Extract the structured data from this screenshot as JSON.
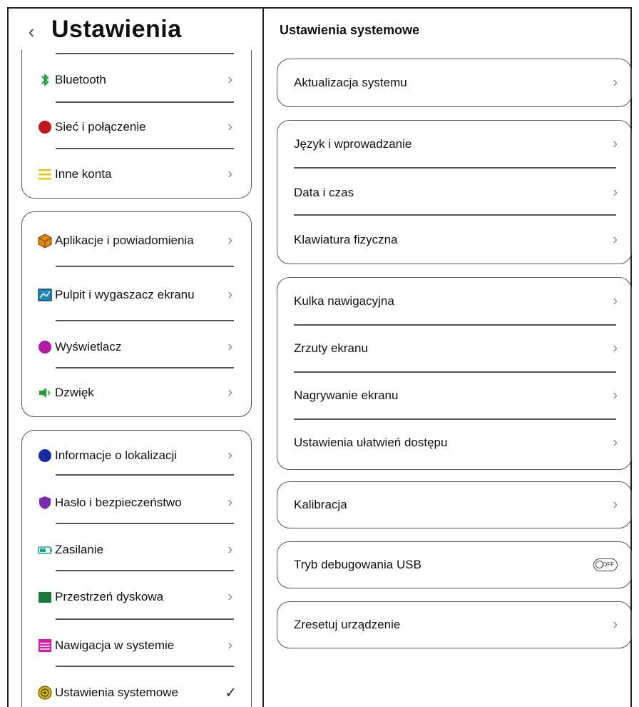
{
  "header": {
    "back_icon": "chevron-left-icon",
    "title": "Ustawienia"
  },
  "sidebar": {
    "groups": [
      {
        "items": [
          {
            "label": "Bluetooth",
            "icon": "bluetooth-icon",
            "color": "#1a9a3a"
          },
          {
            "label": "Sieć i połączenie",
            "icon": "network-icon",
            "color": "#c0181a"
          },
          {
            "label": "Inne konta",
            "icon": "accounts-icon",
            "color": "#e6c800"
          }
        ]
      },
      {
        "items": [
          {
            "label": "Aplikacje i powiadomienia",
            "icon": "apps-icon",
            "color": "#e08a10"
          },
          {
            "label": "Pulpit i wygaszacz ekranu",
            "icon": "desktop-icon",
            "color": "#1e8ab4"
          },
          {
            "label": "Wyświetlacz",
            "icon": "display-icon",
            "color": "#b01aa8"
          },
          {
            "label": "Dzwięk",
            "icon": "sound-icon",
            "color": "#1ea02a"
          }
        ]
      },
      {
        "items": [
          {
            "label": "Informacje o lokalizacji",
            "icon": "location-icon",
            "color": "#1a2aa8"
          },
          {
            "label": "Hasło i bezpieczeństwo",
            "icon": "security-icon",
            "color": "#7a2ab0"
          },
          {
            "label": "Zasilanie",
            "icon": "battery-icon",
            "color": "#18a888"
          },
          {
            "label": "Przestrzeń dyskowa",
            "icon": "storage-icon",
            "color": "#1a7a3a"
          },
          {
            "label": "Nawigacja w systemie",
            "icon": "navigation-icon",
            "color": "#d81aa8"
          },
          {
            "label": "Ustawienia systemowe",
            "icon": "system-settings-icon",
            "color": "#d8c000",
            "selected": true
          }
        ]
      }
    ]
  },
  "main": {
    "title": "Ustawienia systemowe",
    "items": [
      {
        "label": "Aktualizacja systemu"
      },
      {
        "label": "Język i wprowadzanie"
      },
      {
        "label": "Data i czas"
      },
      {
        "label": "Klawiatura fizyczna"
      },
      {
        "label": "Kulka nawigacyjna"
      },
      {
        "label": "Zrzuty ekranu"
      },
      {
        "label": "Nagrywanie ekranu"
      },
      {
        "label": "Ustawienia ułatwień dostępu"
      },
      {
        "label": "Kalibracja"
      },
      {
        "label": "Tryb debugowania USB",
        "toggle": "OFF"
      },
      {
        "label": "Zresetuj urządzenie"
      }
    ]
  }
}
